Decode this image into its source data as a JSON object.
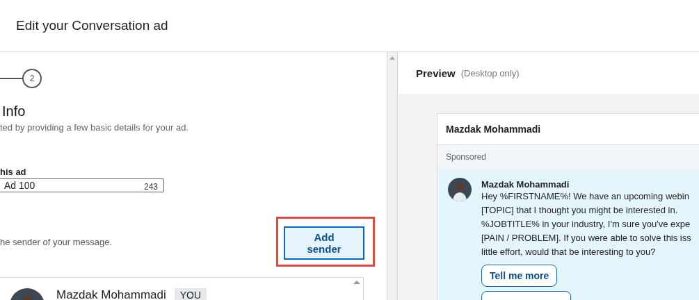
{
  "header": {
    "title": "Edit your Conversation ad"
  },
  "stepper": {
    "step": "2"
  },
  "form": {
    "heading": "Info",
    "subtitle": "ted by providing a few basic details for your ad.",
    "name_field": {
      "label": "his ad",
      "value": "Ad 100",
      "counter": "243"
    },
    "sender": {
      "description": "he sender of your message.",
      "button": "Add sender"
    },
    "senders": [
      {
        "name": "Mazdak Mohammadi",
        "badge": "YOU"
      }
    ]
  },
  "preview": {
    "title": "Preview",
    "note": "(Desktop only)",
    "card": {
      "sender": "Mazdak Mohammadi",
      "sponsored": "Sponsored",
      "message": {
        "author": "Mazdak Mohammadi",
        "lines": [
          "Hey %FIRSTNAME%! We have an upcoming webin",
          "[TOPIC] that I thought you might be interested in.",
          "%JOBTITLE% in your industry, I'm sure you've expe",
          "[PAIN / PROBLEM]. If you were able to solve this iss",
          "little effort, would that be interesting to you?"
        ]
      },
      "replies": [
        "Tell me more"
      ]
    }
  }
}
